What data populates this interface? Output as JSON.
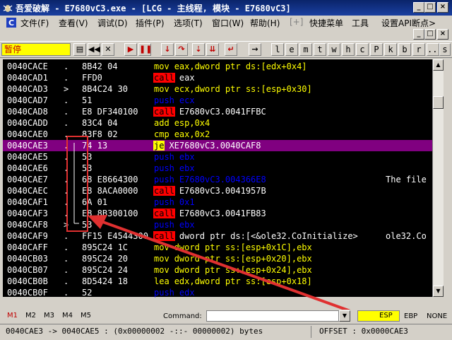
{
  "window": {
    "title": "吾爱破解 - E7680vC3.exe - [LCG - 主线程, 模块 - E7680vC3]",
    "icons": {
      "app": "bug-icon",
      "minimize": "minimize-icon",
      "maximize": "maximize-icon",
      "close": "close-icon"
    }
  },
  "menu": {
    "items": [
      {
        "label": "文件(F)"
      },
      {
        "label": "查看(V)"
      },
      {
        "label": "调试(D)"
      },
      {
        "label": "插件(P)"
      },
      {
        "label": "选项(T)"
      },
      {
        "label": "窗口(W)"
      },
      {
        "label": "帮助(H)"
      },
      {
        "label": "[+]"
      },
      {
        "label": "快捷菜单"
      },
      {
        "label": "工具"
      },
      {
        "label": "设置API断点>"
      }
    ],
    "min_glyph": "_",
    "restore_glyph": "□",
    "close_glyph": "×"
  },
  "toolbar": {
    "state": "暂停",
    "buttons": [
      "open",
      "restart",
      "close",
      "run",
      "pause",
      "step-into",
      "step-over",
      "trace-into",
      "trace-over",
      "execute-till-return",
      "goto"
    ],
    "letters": [
      "l",
      "e",
      "m",
      "t",
      "w",
      "h",
      "c",
      "P",
      "k",
      "b",
      "r",
      "...",
      "s"
    ]
  },
  "disasm": {
    "rows": [
      {
        "addr": "0040CACE",
        "mark": ".",
        "hex": "8B42 04",
        "mn": "mov",
        "ops": "eax,dword ptr ds:[edx+0x4]",
        "cmt": ""
      },
      {
        "addr": "0040CAD1",
        "mark": ".",
        "hex": "FFD0",
        "mn": "call",
        "ops": "eax",
        "cmt": ""
      },
      {
        "addr": "0040CAD3",
        "mark": ">",
        "hex": "8B4C24 30",
        "mn": "mov",
        "ops": "ecx,dword ptr ss:[esp+0x30]",
        "cmt": ""
      },
      {
        "addr": "0040CAD7",
        "mark": ".",
        "hex": "51",
        "mn": "push",
        "ops": "ecx",
        "cmt": ""
      },
      {
        "addr": "0040CAD8",
        "mark": ".",
        "hex": "E8 DF340100",
        "mn": "call",
        "ops": "E7680vC3.0041FFBC",
        "cmt": ""
      },
      {
        "addr": "0040CADD",
        "mark": ".",
        "hex": "83C4 04",
        "mn": "add",
        "ops": "esp,0x4",
        "cmt": ""
      },
      {
        "addr": "0040CAE0",
        "mark": ".",
        "hex": "83F8 02",
        "mn": "cmp",
        "ops": "eax,0x2",
        "cmt": ""
      },
      {
        "addr": "0040CAE3",
        "mark": ".",
        "hex": "74 13",
        "mn": "je",
        "ops": "XE7680vC3.0040CAF8",
        "cmt": "",
        "selected": true
      },
      {
        "addr": "0040CAE5",
        "mark": ".",
        "hex": "53",
        "mn": "push",
        "ops": "ebx",
        "cmt": ""
      },
      {
        "addr": "0040CAE6",
        "mark": ".",
        "hex": "53",
        "mn": "push",
        "ops": "ebx",
        "cmt": ""
      },
      {
        "addr": "0040CAE7",
        "mark": ".",
        "hex": "68 E8664300",
        "mn": "push",
        "ops": "E7680vC3.004366E8",
        "cmt": "The file"
      },
      {
        "addr": "0040CAEC",
        "mark": ".",
        "hex": "E8 8ACA0000",
        "mn": "call",
        "ops": "E7680vC3.0041957B",
        "cmt": ""
      },
      {
        "addr": "0040CAF1",
        "mark": ".",
        "hex": "6A 01",
        "mn": "push",
        "ops": "0x1",
        "cmt": ""
      },
      {
        "addr": "0040CAF3",
        "mark": ".",
        "hex": "E8 8B300100",
        "mn": "call",
        "ops": "E7680vC3.0041FB83",
        "cmt": ""
      },
      {
        "addr": "0040CAF8",
        "mark": ">",
        "hex": "53",
        "mn": "push",
        "ops": "ebx",
        "cmt": ""
      },
      {
        "addr": "0040CAF9",
        "mark": ".",
        "hex": "FF15 E4544300",
        "mn": "call",
        "ops": "dword ptr ds:[<&ole32.CoInitialize>",
        "cmt": "ole32.Co"
      },
      {
        "addr": "0040CAFF",
        "mark": ".",
        "hex": "895C24 1C",
        "mn": "mov",
        "ops": "dword ptr ss:[esp+0x1C],ebx",
        "cmt": ""
      },
      {
        "addr": "0040CB03",
        "mark": ".",
        "hex": "895C24 20",
        "mn": "mov",
        "ops": "dword ptr ss:[esp+0x20],ebx",
        "cmt": ""
      },
      {
        "addr": "0040CB07",
        "mark": ".",
        "hex": "895C24 24",
        "mn": "mov",
        "ops": "dword ptr ss:[esp+0x24],ebx",
        "cmt": ""
      },
      {
        "addr": "0040CB0B",
        "mark": ".",
        "hex": "8D5424 18",
        "mn": "lea",
        "ops": "edx,dword ptr ss:[esp+0x18]",
        "cmt": ""
      },
      {
        "addr": "0040CB0F",
        "mark": ".",
        "hex": "52",
        "mn": "push",
        "ops": "edx",
        "cmt": ""
      }
    ]
  },
  "bottom": {
    "tabs": [
      "M1",
      "M2",
      "M3",
      "M4",
      "M5"
    ],
    "command_label": "Command:",
    "command_value": "",
    "esp_label": "ESP",
    "ebp_label": "EBP",
    "none_label": "NONE"
  },
  "status": {
    "left": "0040CAE3 -> 0040CAE5 : (0x00000002 -::- 00000002) bytes",
    "right": "OFFSET : 0x0000CAE3"
  }
}
